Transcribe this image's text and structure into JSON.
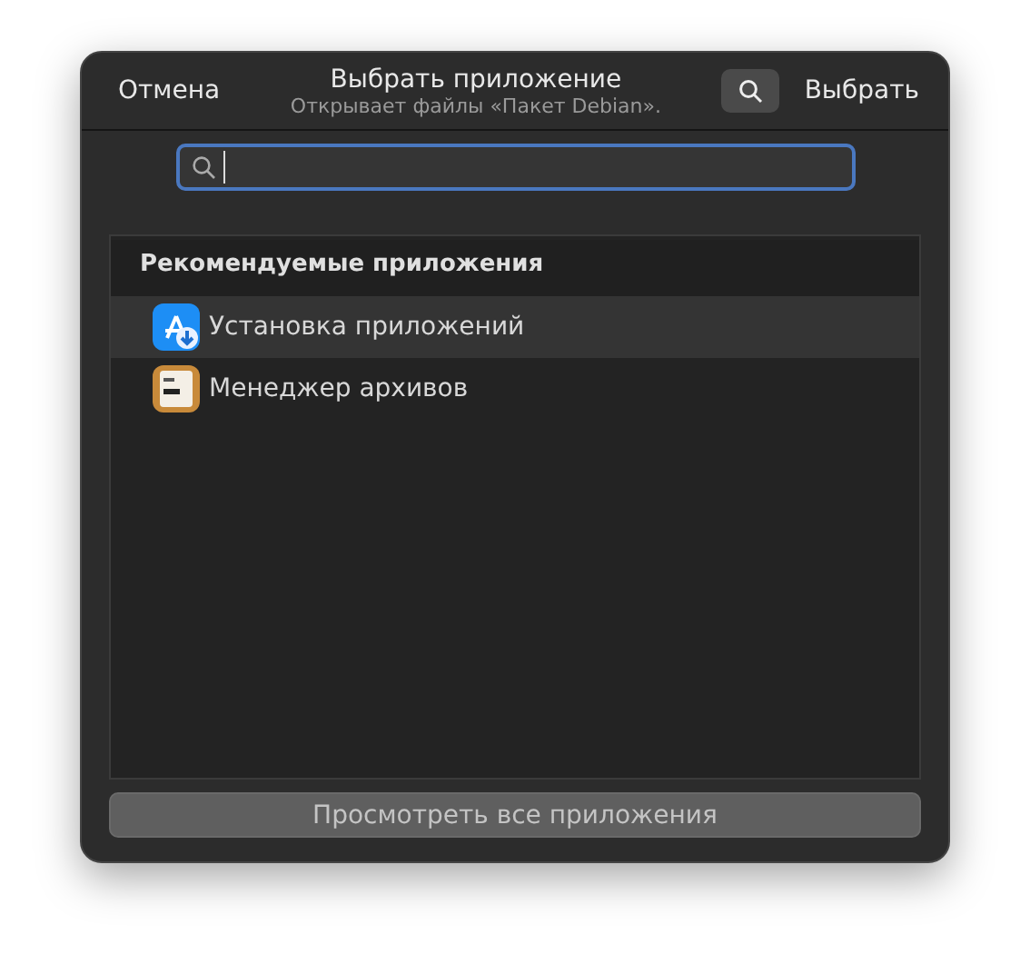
{
  "header": {
    "cancel": "Отмена",
    "title": "Выбрать приложение",
    "subtitle": "Открывает файлы «Пакет Debian».",
    "select": "Выбрать"
  },
  "section": {
    "title": "Рекомендуемые приложения",
    "items": [
      {
        "label": "Установка приложений",
        "kind": "installer",
        "selected": true
      },
      {
        "label": "Менеджер архивов",
        "kind": "archive",
        "selected": false
      }
    ]
  },
  "footer_button": "Просмотреть все приложения"
}
